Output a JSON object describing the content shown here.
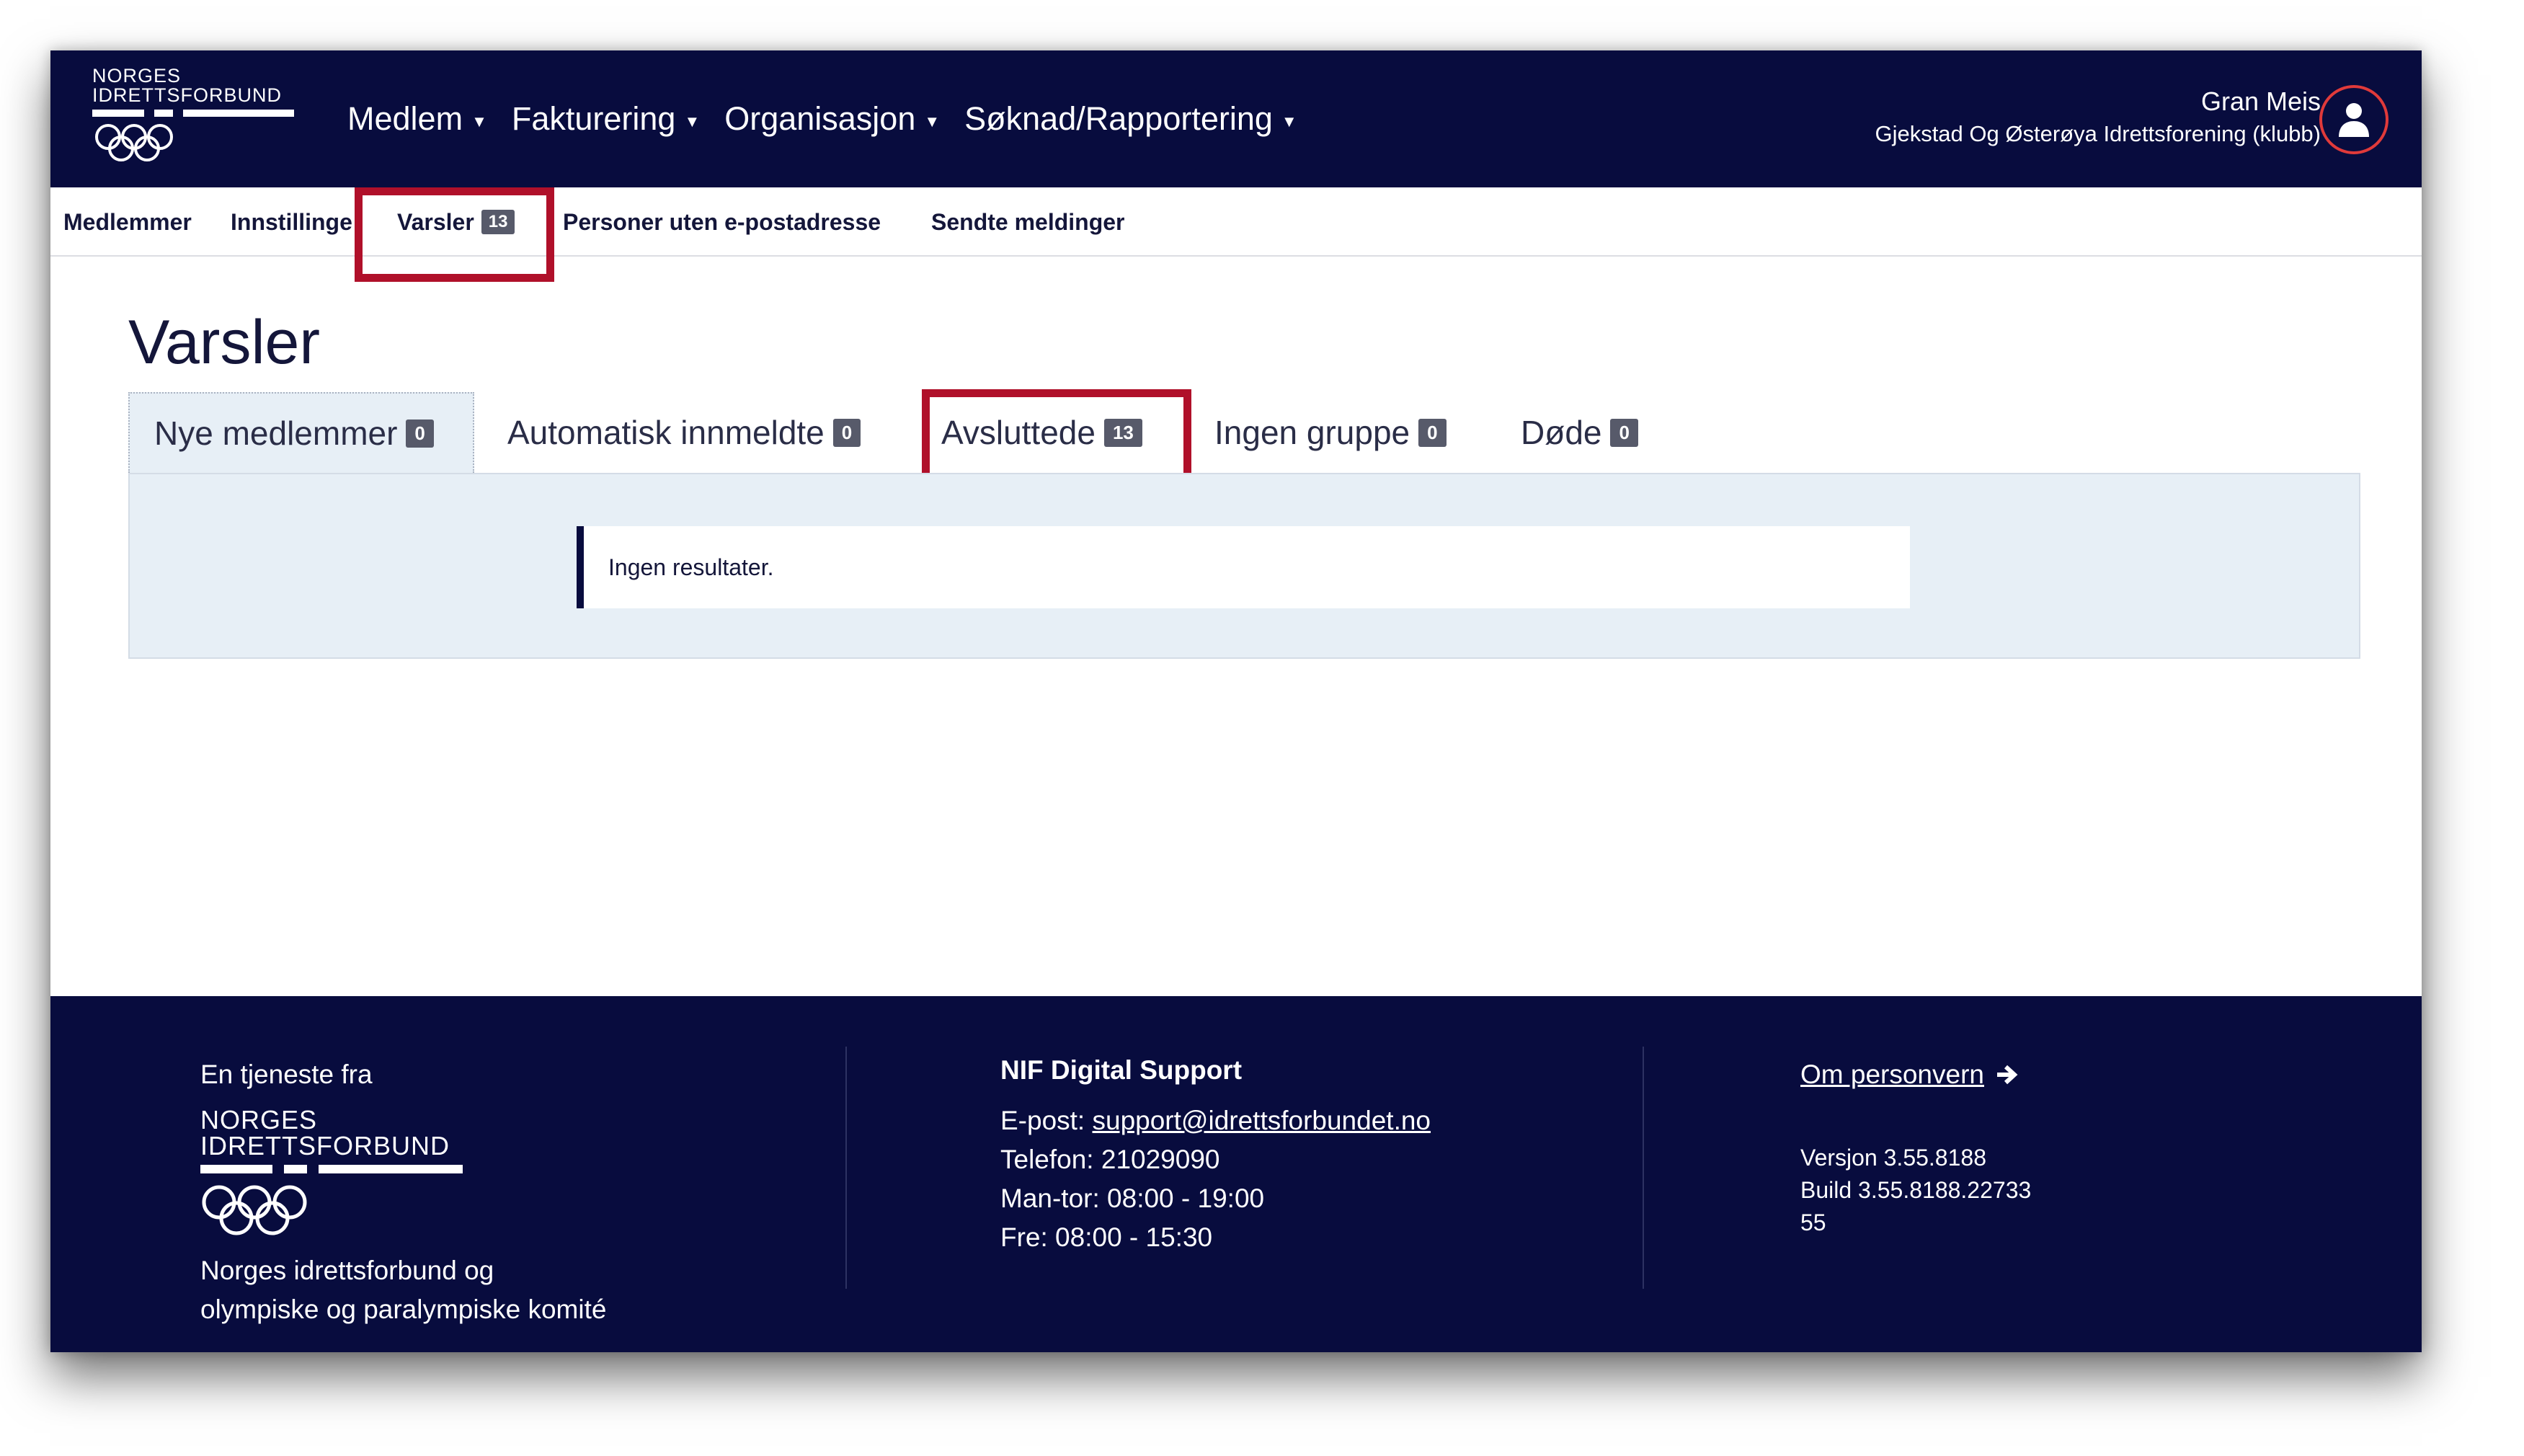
{
  "header": {
    "logo_lines": [
      "NORGES",
      "IDRETTSFORBUND"
    ],
    "nav": [
      {
        "label": "Medlem"
      },
      {
        "label": "Fakturering"
      },
      {
        "label": "Organisasjon"
      },
      {
        "label": "Søknad/Rapportering"
      }
    ],
    "user_name": "Gran Meis",
    "user_org": "Gjekstad Og Østerøya Idrettsforening (klubb)",
    "accent_color": "#080c3e"
  },
  "subnav": {
    "items": [
      {
        "label": "Medlemmer"
      },
      {
        "label": "Innstillinge"
      },
      {
        "label": "Varsler",
        "badge": "13"
      },
      {
        "label": "Personer uten e-postadresse"
      },
      {
        "label": "Sendte meldinger"
      }
    ]
  },
  "main": {
    "title": "Varsler",
    "tabs": [
      {
        "label": "Nye medlemmer",
        "badge": "0"
      },
      {
        "label": "Automatisk innmeldte",
        "badge": "0"
      },
      {
        "label": "Avsluttede",
        "badge": "13"
      },
      {
        "label": "Ingen gruppe",
        "badge": "0"
      },
      {
        "label": "Døde",
        "badge": "0"
      }
    ],
    "empty_message": "Ingen resultater."
  },
  "footer": {
    "service_from": "En tjeneste fra",
    "logo_lines": [
      "NORGES",
      "IDRETTSFORBUND"
    ],
    "org_line1": "Norges idrettsforbund og",
    "org_line2": "olympiske og paralympiske komité",
    "support_title": "NIF Digital Support",
    "email_label": "E-post:",
    "email": "support@idrettsforbundet.no",
    "phone": "Telefon: 21029090",
    "hours_weekdays": "Man-tor: 08:00 - 19:00",
    "hours_friday": "Fre: 08:00 - 15:30",
    "privacy_link": "Om personvern",
    "version": "Versjon 3.55.8188",
    "build_line1": "Build 3.55.8188.22733",
    "build_line2": "55"
  },
  "highlight_color": "#b0102a"
}
